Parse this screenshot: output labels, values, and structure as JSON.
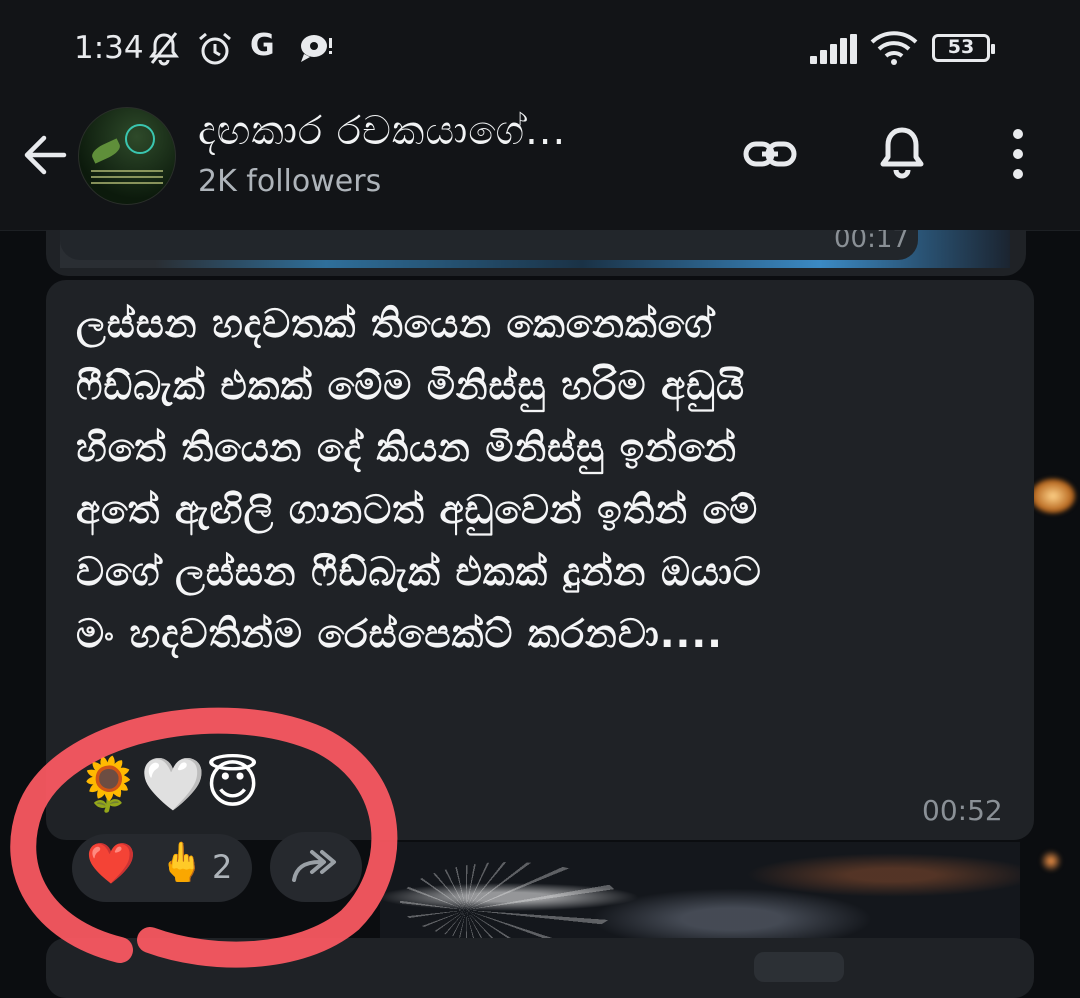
{
  "status_bar": {
    "time": "1:34",
    "icons": [
      "mute-bell-icon",
      "alarm-icon",
      "google-icon",
      "chat-notification-icon"
    ],
    "google_glyph": "G",
    "battery": "53"
  },
  "header": {
    "channel_name": "දඟකාර රචකයාගේ...",
    "followers": "2K followers",
    "actions": [
      "link-icon",
      "bell-icon",
      "more-vert-icon"
    ]
  },
  "previous_message": {
    "time": "00:17"
  },
  "message": {
    "lines": [
      "ලස්සන හදවතක් තියෙන කෙනෙක්ගේ",
      "ෆීඩ්බැක් එකක් මේම මිනිස්සු හරිම අඩුයි",
      "හිතේ තියෙන දේ කියන මිනිස්සු ඉන්නේ",
      "අතේ ඇඟිලි ගානටත් අඩුවෙන් ඉතින් මේ",
      "වගේ ලස්සන ෆීඩ්බැක් එකක් දුන්න ඔයාට",
      "මං හදවතින්ම රෙස්පෙක්ට් කරනවා...."
    ],
    "emojis": "🌻🤍😇",
    "time": "00:52"
  },
  "reactions": {
    "first": "❤️",
    "second": "🖕",
    "count": "2"
  },
  "colors": {
    "bubble": "#1f2226",
    "background": "#0b0d10",
    "annotation": "#ff5a63"
  }
}
